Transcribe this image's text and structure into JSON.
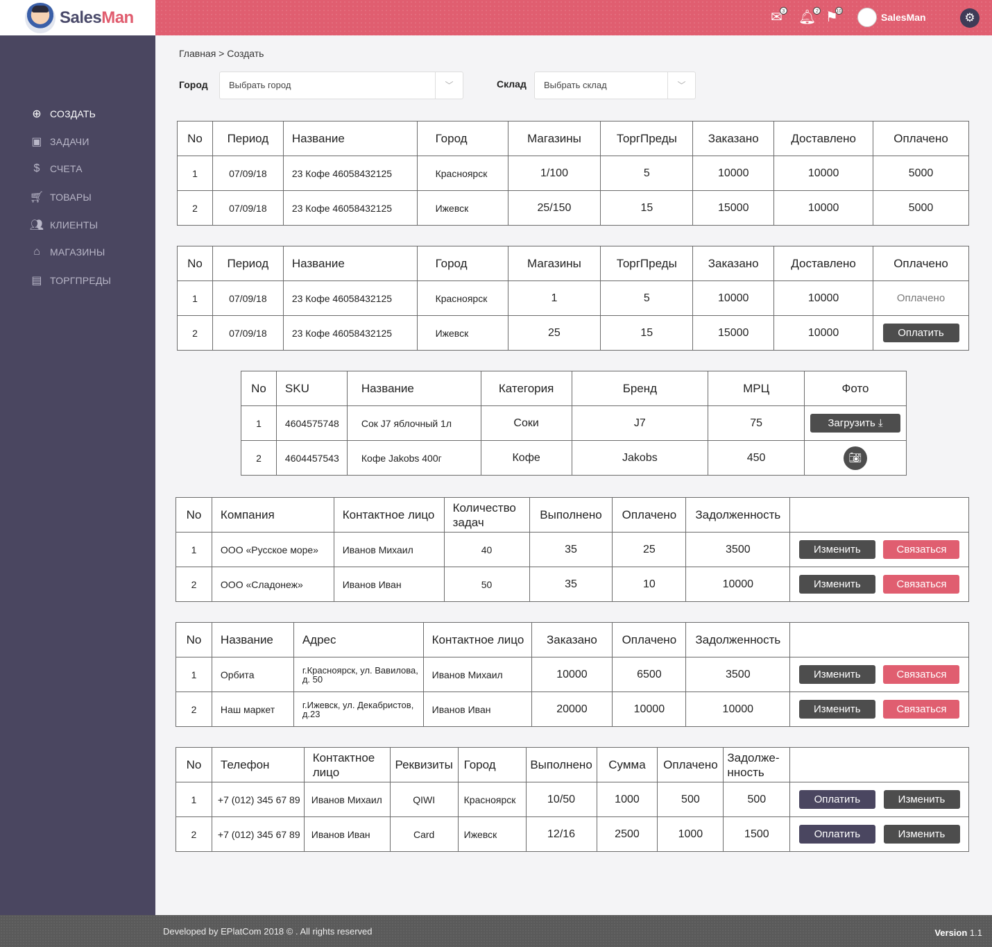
{
  "brand": {
    "part1": "Sales",
    "part2": "Man"
  },
  "header": {
    "mail_badge": "3",
    "bell_badge": "2",
    "flag_badge": "10",
    "username": "SalesMan"
  },
  "sidebar": {
    "items": [
      {
        "label": "СОЗДАТЬ",
        "icon": "create-icon"
      },
      {
        "label": "ЗАДАЧИ",
        "icon": "tasks-icon"
      },
      {
        "label": "СЧЕТА",
        "icon": "dollar-icon"
      },
      {
        "label": "ТОВАРЫ",
        "icon": "cart-icon"
      },
      {
        "label": "КЛИЕНТЫ",
        "icon": "clients-icon"
      },
      {
        "label": "МАГАЗИНЫ",
        "icon": "store-icon"
      },
      {
        "label": "ТОРГПРЕДЫ",
        "icon": "box-icon"
      }
    ]
  },
  "breadcrumb": "Главная > Создать",
  "filters": {
    "city_label": "Город",
    "city_placeholder": "Выбрать город",
    "warehouse_label": "Склад",
    "warehouse_placeholder": "Выбрать склад"
  },
  "table1": {
    "headers": [
      "No",
      "Период",
      "Название",
      "Город",
      "Магазины",
      "ТоргПреды",
      "Заказано",
      "Доставлено",
      "Оплачено"
    ],
    "rows": [
      [
        "1",
        "07/09/18",
        "23 Кофе 46058432125",
        "Красноярск",
        "1/100",
        "5",
        "10000",
        "10000",
        "5000"
      ],
      [
        "2",
        "07/09/18",
        "23 Кофе 46058432125",
        "Ижевск",
        "25/150",
        "15",
        "15000",
        "10000",
        "5000"
      ]
    ]
  },
  "table2": {
    "headers": [
      "No",
      "Период",
      "Название",
      "Город",
      "Магазины",
      "ТоргПреды",
      "Заказано",
      "Доставлено",
      "Оплачено"
    ],
    "rows": [
      [
        "1",
        "07/09/18",
        "23 Кофе 46058432125",
        "Красноярск",
        "1",
        "5",
        "10000",
        "10000"
      ],
      [
        "2",
        "07/09/18",
        "23 Кофе 46058432125",
        "Ижевск",
        "25",
        "15",
        "15000",
        "10000"
      ]
    ],
    "paid_text": "Оплачено",
    "pay_button": "Оплатить"
  },
  "table3": {
    "headers": [
      "No",
      "SKU",
      "Название",
      "Категория",
      "Бренд",
      "МРЦ",
      "Фото"
    ],
    "rows": [
      [
        "1",
        "4604575748",
        "Сок J7 яблочный 1л",
        "Соки",
        "J7",
        "75"
      ],
      [
        "2",
        "4604457543",
        "Кофе Jakobs 400г",
        "Кофе",
        "Jakobs",
        "450"
      ]
    ],
    "upload_button": "Загрузить"
  },
  "table4": {
    "headers": [
      "No",
      "Компания",
      "Контактное лицо",
      "Количество задач",
      "Выполнено",
      "Оплачено",
      "Задолженность"
    ],
    "rows": [
      [
        "1",
        "ООО «Русское море»",
        "Иванов Михаил",
        "40",
        "35",
        "25",
        "3500"
      ],
      [
        "2",
        "ООО «Сладонеж»",
        "Иванов Иван",
        "50",
        "35",
        "10",
        "10000"
      ]
    ],
    "edit_button": "Изменить",
    "contact_button": "Связаться"
  },
  "table5": {
    "headers": [
      "No",
      "Название",
      "Адрес",
      "Контактное лицо",
      "Заказано",
      "Оплачено",
      "Задолженность"
    ],
    "rows": [
      [
        "1",
        "Орбита",
        "г.Красноярск, ул. Вавилова, д. 50",
        "Иванов Михаил",
        "10000",
        "6500",
        "3500"
      ],
      [
        "2",
        "Наш маркет",
        "г.Ижевск, ул. Декабристов, д.23",
        "Иванов Иван",
        "20000",
        "10000",
        "10000"
      ]
    ],
    "edit_button": "Изменить",
    "contact_button": "Связаться"
  },
  "table6": {
    "headers": [
      "No",
      "Телефон",
      "Контактное лицо",
      "Реквизиты",
      "Город",
      "Выполнено",
      "Сумма",
      "Оплачено",
      "Задолже-нность"
    ],
    "rows": [
      [
        "1",
        "+7 (012) 345 67 89",
        "Иванов Михаил",
        "QIWI",
        "Красноярск",
        "10/50",
        "1000",
        "500",
        "500"
      ],
      [
        "2",
        "+7 (012) 345 67 89",
        "Иванов Иван",
        "Card",
        "Ижевск",
        "12/16",
        "2500",
        "1000",
        "1500"
      ]
    ],
    "pay_button": "Оплатить",
    "edit_button": "Изменить"
  },
  "footer": {
    "copyright": "Developed by EPlatCom 2018 © . All rights reserved",
    "version_label": "Version",
    "version_value": "1.1"
  },
  "colors": {
    "accent": "#e05e70",
    "sidebar": "#4a4660",
    "button_dark": "#4d4d4d"
  }
}
